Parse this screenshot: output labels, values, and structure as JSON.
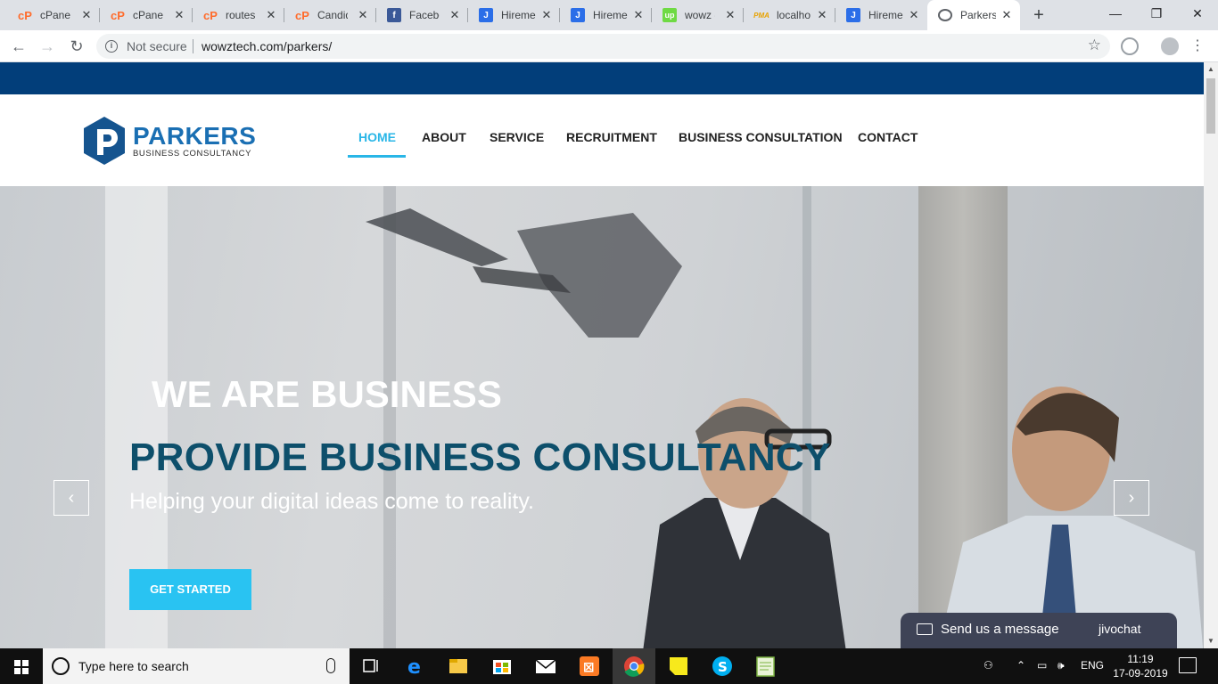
{
  "browser": {
    "tabs": [
      {
        "title": "cPanel",
        "icon": "cpanel-icon"
      },
      {
        "title": "cPanel",
        "icon": "cpanel-icon"
      },
      {
        "title": "routes.p",
        "icon": "cpanel-icon"
      },
      {
        "title": "Candid",
        "icon": "cpanel-icon"
      },
      {
        "title": "Facebo",
        "icon": "facebook-icon"
      },
      {
        "title": "Hireme",
        "icon": "jira-icon"
      },
      {
        "title": "Hireme",
        "icon": "jira-icon"
      },
      {
        "title": "wowz -",
        "icon": "upwork-icon"
      },
      {
        "title": "localho",
        "icon": "phpmyadmin-icon"
      },
      {
        "title": "Hireme",
        "icon": "jira-icon"
      },
      {
        "title": "Parkers",
        "icon": "globe-icon",
        "active": true
      }
    ],
    "security_label": "Not secure",
    "url": "wowztech.com/parkers/"
  },
  "site": {
    "logo_name": "PARKERS",
    "logo_tagline": "BUSINESS CONSULTANCY",
    "nav": [
      "HOME",
      "ABOUT",
      "SERVICE",
      "RECRUITMENT",
      "BUSINESS CONSULTATION",
      "CONTACT"
    ],
    "active_nav": "HOME",
    "colors": {
      "top_band": "#023e7a",
      "accent": "#29b6e7",
      "headline": "#0d4f6b",
      "button": "#29c3f2"
    }
  },
  "hero": {
    "line1": "WE ARE BUSINESS",
    "line2": "PROVIDE BUSINESS CONSULTANCY",
    "line3": "Helping your digital ideas come to reality.",
    "cta": "GET STARTED",
    "prev": "‹",
    "next": "›"
  },
  "chat": {
    "label": "Send us a message",
    "brand": "jivochat"
  },
  "taskbar": {
    "search_placeholder": "Type here to search",
    "language": "ENG",
    "time": "11:19",
    "date": "17-09-2019"
  }
}
